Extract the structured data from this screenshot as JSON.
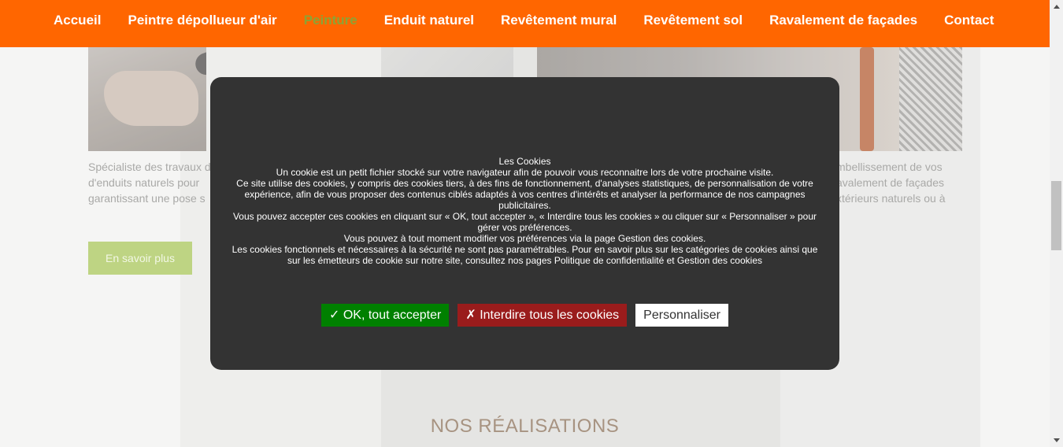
{
  "nav": {
    "items": [
      {
        "label": "Accueil",
        "active": false
      },
      {
        "label": "Peintre dépollueur d'air",
        "active": false
      },
      {
        "label": "Peinture",
        "active": true
      },
      {
        "label": "Enduit naturel",
        "active": false
      },
      {
        "label": "Revêtement mural",
        "active": false
      },
      {
        "label": "Revêtement sol",
        "active": false
      },
      {
        "label": "Ravalement de façades",
        "active": false
      },
      {
        "label": "Contact",
        "active": false
      }
    ]
  },
  "background": {
    "left_text": "Spécialiste des travaux d\nd'enduits naturels pour\ngarantissant une pose s",
    "right_text": "mbellissement de vos\navalement de façades\nxtérieurs naturels ou à",
    "more_button": "En savoir plus",
    "section_title": "NOS RÉALISATIONS"
  },
  "cookie": {
    "title": "Les Cookies",
    "line1": "Un cookie est un petit fichier stocké sur votre navigateur afin de pouvoir vous reconnaitre lors de votre prochaine visite.",
    "line2": "Ce site utilise des cookies, y compris des cookies tiers, à des fins de fonctionnement, d'analyses statistiques, de personnalisation de votre expérience, afin de vous proposer des contenus ciblés adaptés à vos centres d'intérêts et analyser la performance de nos campagnes publicitaires.",
    "line3": "Vous pouvez accepter ces cookies en cliquant sur « OK, tout accepter », «  Interdire tous les cookies  » ou cliquer sur « Personnaliser » pour gérer vos préférences.",
    "line4": "Vous pouvez à tout moment modifier vos préférences via la page Gestion des cookies.",
    "line5": "Les cookies fonctionnels et nécessaires à la sécurité ne sont pas paramétrables. Pour en savoir plus sur les catégories de cookies ainsi que sur les émetteurs de cookie sur notre site, consultez nos pages Politique de confidentialité et Gestion des cookies",
    "accept_label": "✓ OK, tout accepter",
    "deny_label": "✗ Interdire tous les cookies",
    "customize_label": "Personnaliser"
  },
  "colors": {
    "nav_bg": "#ff6600",
    "nav_active": "#8ca335",
    "modal_bg": "#333333",
    "accept_bg": "#008000",
    "deny_bg": "#9a1c1c"
  }
}
